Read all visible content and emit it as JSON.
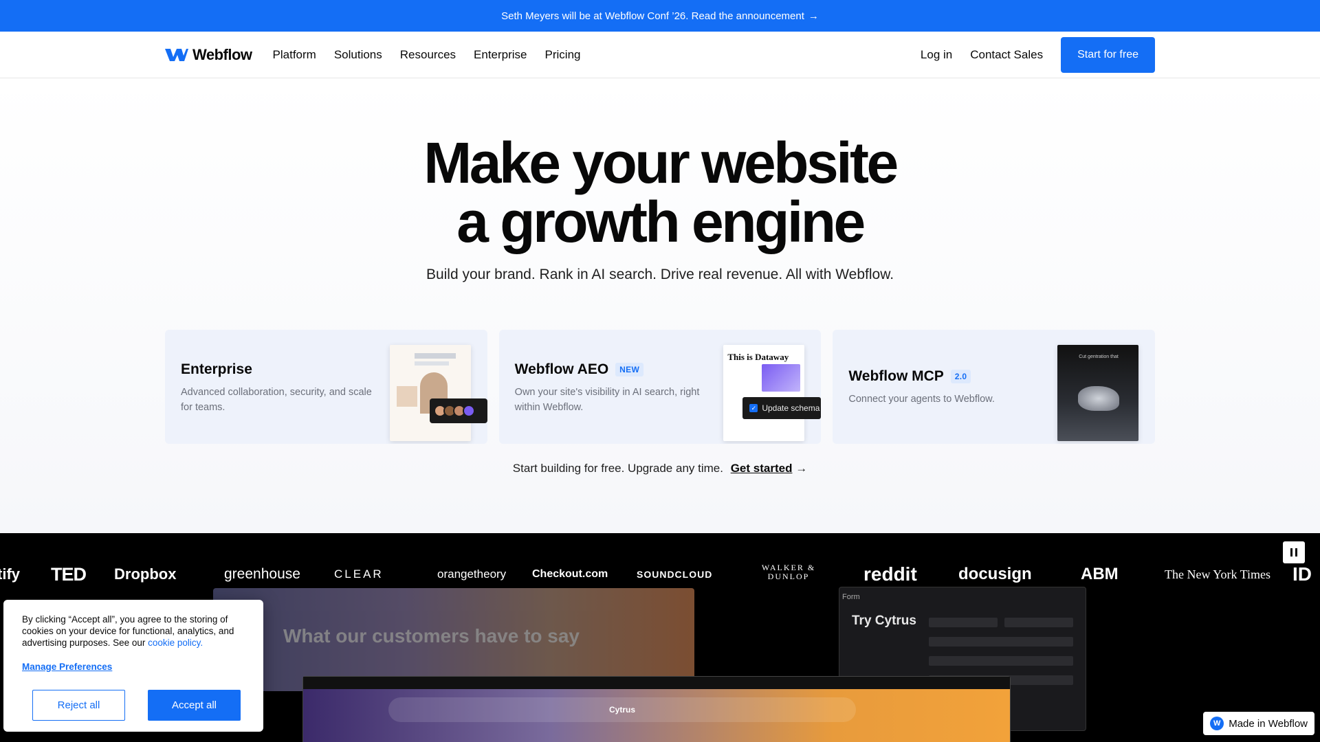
{
  "announcement": {
    "text": "Seth Meyers will be at Webflow Conf ’26. Read the announcement",
    "arrow": "→"
  },
  "nav": {
    "logo": "Webflow",
    "links": [
      "Platform",
      "Solutions",
      "Resources",
      "Enterprise",
      "Pricing"
    ],
    "login": "Log in",
    "contact": "Contact Sales",
    "cta": "Start for free"
  },
  "hero": {
    "title_line1": "Make your website",
    "title_line2": "a growth engine",
    "subtitle": "Build your brand. Rank in AI search. Drive real revenue. All with Webflow."
  },
  "cards": [
    {
      "title": "Enterprise",
      "desc": "Advanced collaboration, security, and scale for teams.",
      "badge": ""
    },
    {
      "title": "Webflow AEO",
      "badge": "NEW",
      "desc": "Own your site's visibility in AI search, right within Webflow.",
      "thumb_title": "This is Dataway",
      "chip": "Update schema"
    },
    {
      "title": "Webflow MCP",
      "badge": "2.0",
      "desc": "Connect your agents to Webflow.",
      "thumb_title": "Cut gentration that"
    }
  ],
  "start": {
    "text": "Start building for free. Upgrade any time.",
    "link": "Get started",
    "arrow": "→"
  },
  "logos": [
    "tify",
    "TED",
    "Dropbox",
    "greenhouse",
    "CLEAR",
    "orangetheory",
    "Checkout.com",
    "SOUNDCLOUD",
    "WALKER & DUNLOP",
    "reddit",
    "docusign",
    "ABM",
    "The New York Times",
    "ID"
  ],
  "showcase": {
    "quote": "What our customers have to say",
    "form_title": "Try Cytrus",
    "site_name": "Cytrus",
    "form_label": "Form"
  },
  "cookie": {
    "text": "By clicking “Accept all”, you agree to the storing of cookies on your device for functional, analytics, and advertising purposes. See our",
    "policy": "cookie policy.",
    "manage": "Manage Preferences",
    "reject": "Reject all",
    "accept": "Accept all"
  },
  "made_in": "Made in Webflow",
  "colors": {
    "brand": "#146ef5",
    "text": "#080808",
    "dark": "#000000"
  }
}
